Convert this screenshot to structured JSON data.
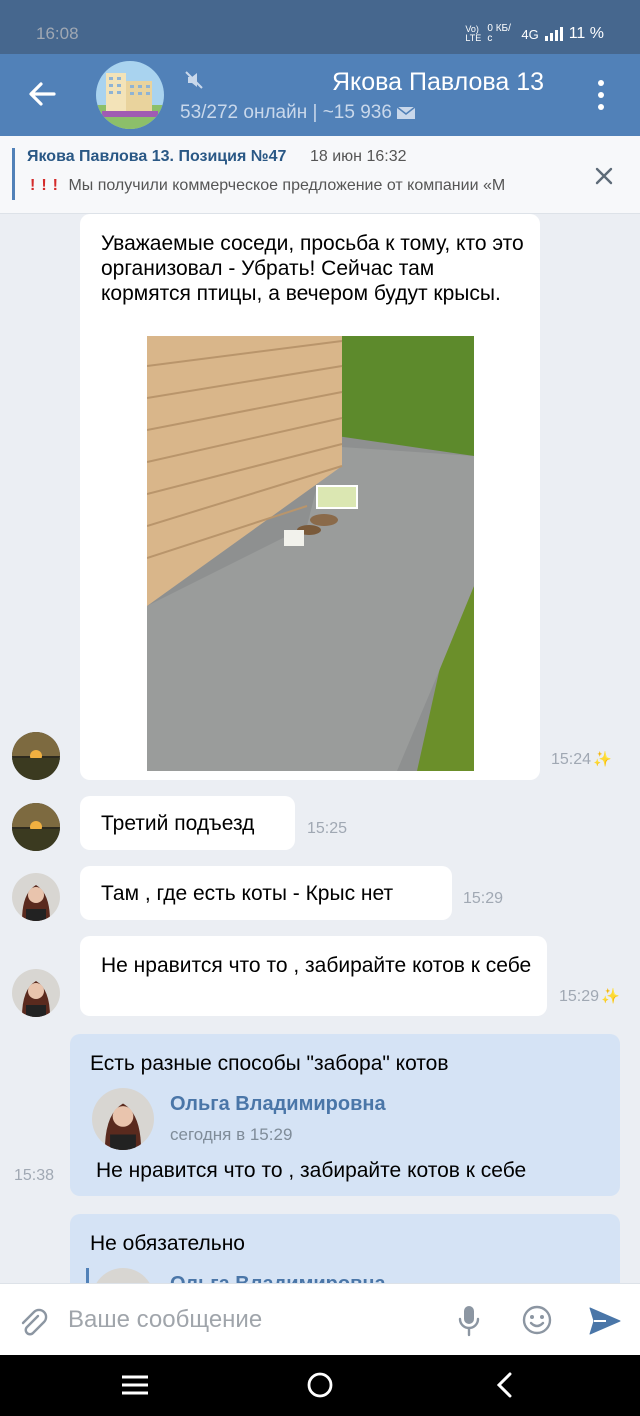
{
  "status_bar": {
    "time": "16:08",
    "volte": "Vo) LTE",
    "speed": "0 КБ/с",
    "network": "4G",
    "battery": "11 %"
  },
  "header": {
    "title": "Якова Павлова 13",
    "subtitle": "53/272 онлайн | ~15 936",
    "icons": [
      "back-arrow-icon",
      "mute-icon",
      "mail-icon",
      "more-icon"
    ]
  },
  "pinned": {
    "title": "Якова Павлова 13. Позиция №47",
    "date": "18 июн 16:32",
    "marks": "!!!",
    "text": "Мы получили коммерческое предложение от компании «М"
  },
  "messages": [
    {
      "text": "Уважаемые соседи, просьба к тому, кто это организовал - Убрать! Сейчас там кормятся птицы, а вечером будут крысы.",
      "time": "15:24",
      "has_photo": true
    },
    {
      "text": "Третий подъезд",
      "time": "15:25"
    },
    {
      "text": "Там , где есть коты - Крыс нет",
      "time": "15:29"
    },
    {
      "text": "Не нравится что то , забирайте котов к себе",
      "time": "15:29"
    }
  ],
  "outgoing": [
    {
      "text": "Есть разные способы \"забора\" котов",
      "time": "15:38",
      "reply": {
        "author": "Ольга Владимировна",
        "date": "сегодня в 15:29",
        "text": "Не нравится что то , забирайте котов к себе"
      }
    },
    {
      "text": "Не обязательно",
      "reply": {
        "author": "Ольга Владимировна"
      }
    }
  ],
  "composer": {
    "placeholder": "Ваше сообщение"
  },
  "colors": {
    "header": "#5181b8",
    "status_bar": "#46678e",
    "outgoing_bubble": "#d5e3f5",
    "link": "#2a5885"
  }
}
